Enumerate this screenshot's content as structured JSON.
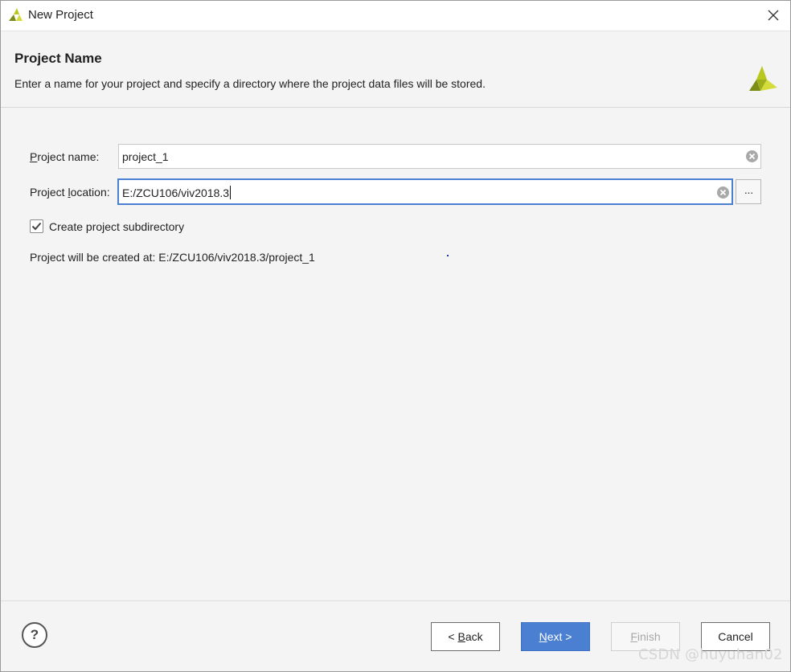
{
  "window": {
    "title": "New Project",
    "close_icon": "close-icon"
  },
  "header": {
    "title": "Project Name",
    "description": "Enter a name for your project and specify a directory where the project data files will be stored."
  },
  "form": {
    "name_label_first": "P",
    "name_label_rest": "roject name:",
    "name_value": "project_1",
    "location_label_first": "Project ",
    "location_label_underlined": "l",
    "location_label_rest": "ocation:",
    "location_value": "E:/ZCU106/viv2018.3",
    "browse_label": "···",
    "subdirectory_label": "Create project subdirectory",
    "subdirectory_checked": true,
    "result_text": "Project will be created at: E:/ZCU106/viv2018.3/project_1"
  },
  "footer": {
    "help_label": "?",
    "back_prefix": "< ",
    "back_underlined": "B",
    "back_rest": "ack",
    "next_underlined": "N",
    "next_rest": "ext >",
    "finish_underlined": "F",
    "finish_rest": "inish",
    "cancel_label": "Cancel"
  },
  "watermark": "CSDN @huyuhan02",
  "colors": {
    "accent": "#4a7fd2",
    "logo_dark": "#8a9a1b",
    "logo_light": "#c9d42a"
  }
}
